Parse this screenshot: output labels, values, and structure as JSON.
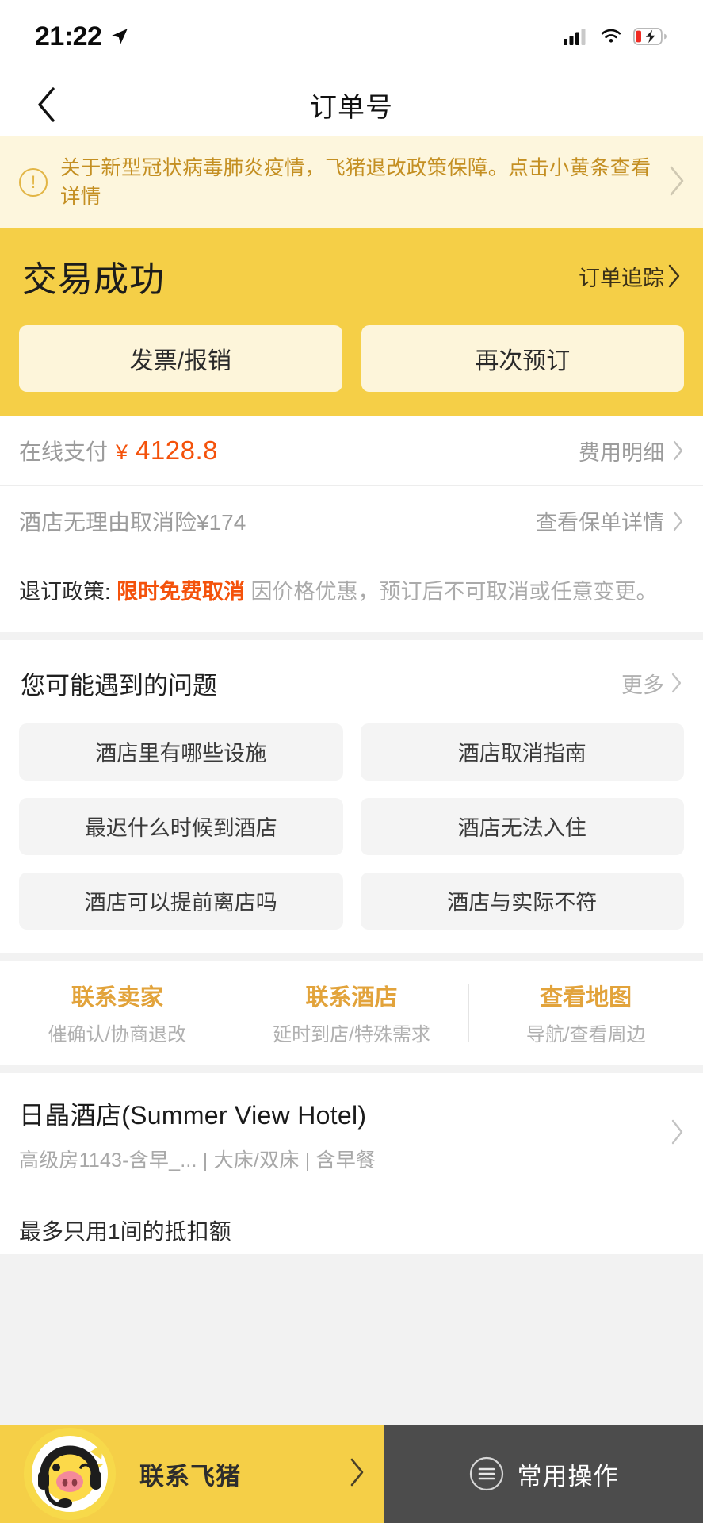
{
  "statusbar": {
    "time": "21:22",
    "icons": [
      "location-arrow-icon",
      "cellular-signal-icon",
      "wifi-icon",
      "battery-charging-icon"
    ]
  },
  "navbar": {
    "back_icon": "chevron-left-icon",
    "title": "订单号"
  },
  "notice": {
    "icon": "exclamation-circle-icon",
    "text": "关于新型冠状病毒肺炎疫情，飞猪退改政策保障。点击小黄条查看详情",
    "chevron": "chevron-right-icon",
    "bg_color": "#fdf6dd",
    "text_color": "#c48f22"
  },
  "status_card": {
    "title": "交易成功",
    "track_label": "订单追踪",
    "track_chevron": "chevron-right-icon",
    "bg_color": "#f5cf47",
    "buttons": [
      {
        "label": "发票/报销"
      },
      {
        "label": "再次预订"
      }
    ]
  },
  "payment": {
    "rows": [
      {
        "label": "在线支付",
        "currency": "¥",
        "amount": "4128.8",
        "action": "费用明细",
        "chevron": "chevron-right-icon",
        "amount_color": "#f4520b"
      },
      {
        "label": "酒店无理由取消险¥174",
        "action": "查看保单详情",
        "chevron": "chevron-right-icon"
      }
    ]
  },
  "policy": {
    "key": "退订政策:",
    "highlight": "限时免费取消",
    "rest": "因价格优惠，预订后不可取消或任意变更。",
    "highlight_color": "#f4520b"
  },
  "faq": {
    "title": "您可能遇到的问题",
    "more_label": "更多",
    "more_chevron": "chevron-right-icon",
    "chips": [
      "酒店里有哪些设施",
      "酒店取消指南",
      "最迟什么时候到酒店",
      "酒店无法入住",
      "酒店可以提前离店吗",
      "酒店与实际不符"
    ]
  },
  "contacts": [
    {
      "title": "联系卖家",
      "sub": "催确认/协商退改"
    },
    {
      "title": "联系酒店",
      "sub": "延时到店/特殊需求"
    },
    {
      "title": "查看地图",
      "sub": "导航/查看周边"
    }
  ],
  "hotel": {
    "name": "日晶酒店(Summer View Hotel)",
    "sub": "高级房1143-含早_... | 大床/双床 | 含早餐",
    "chevron": "chevron-right-icon"
  },
  "clipped_row": {
    "text": "最多只用1间的抵扣额"
  },
  "bottombar": {
    "mascot_icon": "feizhu-pig-headset-icon",
    "left_label": "联系飞猪",
    "left_chevron": "chevron-right-icon",
    "right_icon": "list-menu-circle-icon",
    "right_label": "常用操作",
    "left_bg": "#f5cf47",
    "right_bg": "#4c4c4c"
  }
}
